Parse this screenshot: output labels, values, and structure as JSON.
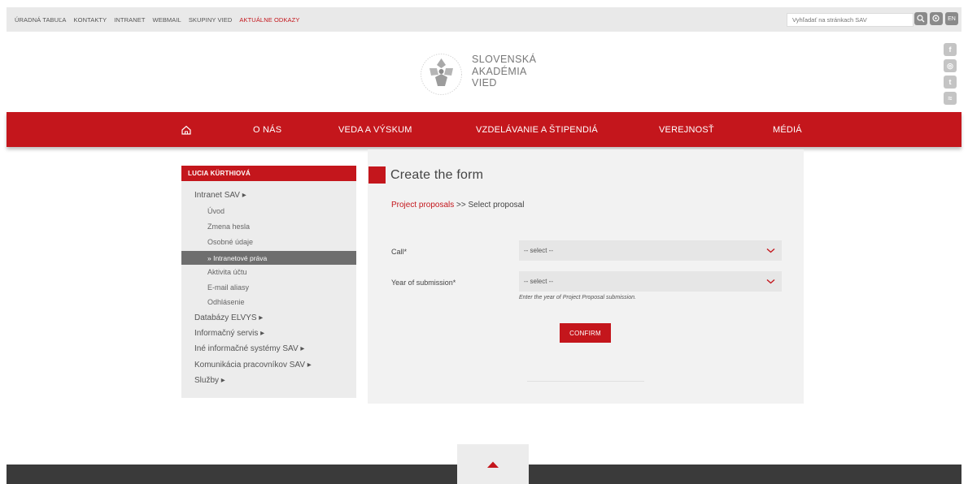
{
  "topbar": {
    "links": [
      {
        "label": "ÚRADNÁ TABUĽA"
      },
      {
        "label": "KONTAKTY"
      },
      {
        "label": "INTRANET"
      },
      {
        "label": "WEBMAIL"
      },
      {
        "label": "SKUPINY VIED"
      },
      {
        "label": "AKTUÁLNE ODKAZY"
      }
    ],
    "search_placeholder": "Vyhľadať na stránkach SAV",
    "lang_label": "EN"
  },
  "header": {
    "logo_line1": "SLOVENSKÁ",
    "logo_line2": "AKADÉMIA",
    "logo_line3": "VIED"
  },
  "social": {
    "facebook": "f",
    "instagram": "◎",
    "twitter": "t",
    "rss": "≈"
  },
  "nav": {
    "items": [
      {
        "label": "O NÁS"
      },
      {
        "label": "VEDA A VÝSKUM"
      },
      {
        "label": "VZDELÁVANIE A ŠTIPENDIÁ"
      },
      {
        "label": "VEREJNOSŤ"
      },
      {
        "label": "MÉDIÁ"
      }
    ]
  },
  "sidebar": {
    "user": "LUCIA KÜRTHIOVÁ",
    "section": "Intranet SAV ▸",
    "sub_items": [
      {
        "label": "Úvod"
      },
      {
        "label": "Zmena hesla"
      },
      {
        "label": "Osobné údaje"
      },
      {
        "label": "» Intranetové práva"
      },
      {
        "label": "Aktivita účtu"
      },
      {
        "label": "E-mail aliasy"
      },
      {
        "label": "Odhlásenie"
      }
    ],
    "more_sections": [
      {
        "label": "Databázy ELVYS ▸"
      },
      {
        "label": "Informačný servis ▸"
      },
      {
        "label": "Iné informačné systémy SAV ▸"
      },
      {
        "label": "Komunikácia pracovníkov SAV ▸"
      },
      {
        "label": "Služby ▸"
      }
    ]
  },
  "form": {
    "title": "Create the form",
    "breadcrumb_link": "Project proposals",
    "breadcrumb_rest": " >> Select proposal",
    "call_label": "Call*",
    "call_value": "-- select --",
    "year_label": "Year of submission*",
    "year_value": "-- select --",
    "year_hint": "Enter the year of Project Proposal submission.",
    "confirm_label": "CONFIRM"
  },
  "colors": {
    "brand_red": "#c4161c",
    "sidebar_bg": "#ececec",
    "active_item": "#6e6e6e",
    "footer": "#3a3a3a"
  }
}
